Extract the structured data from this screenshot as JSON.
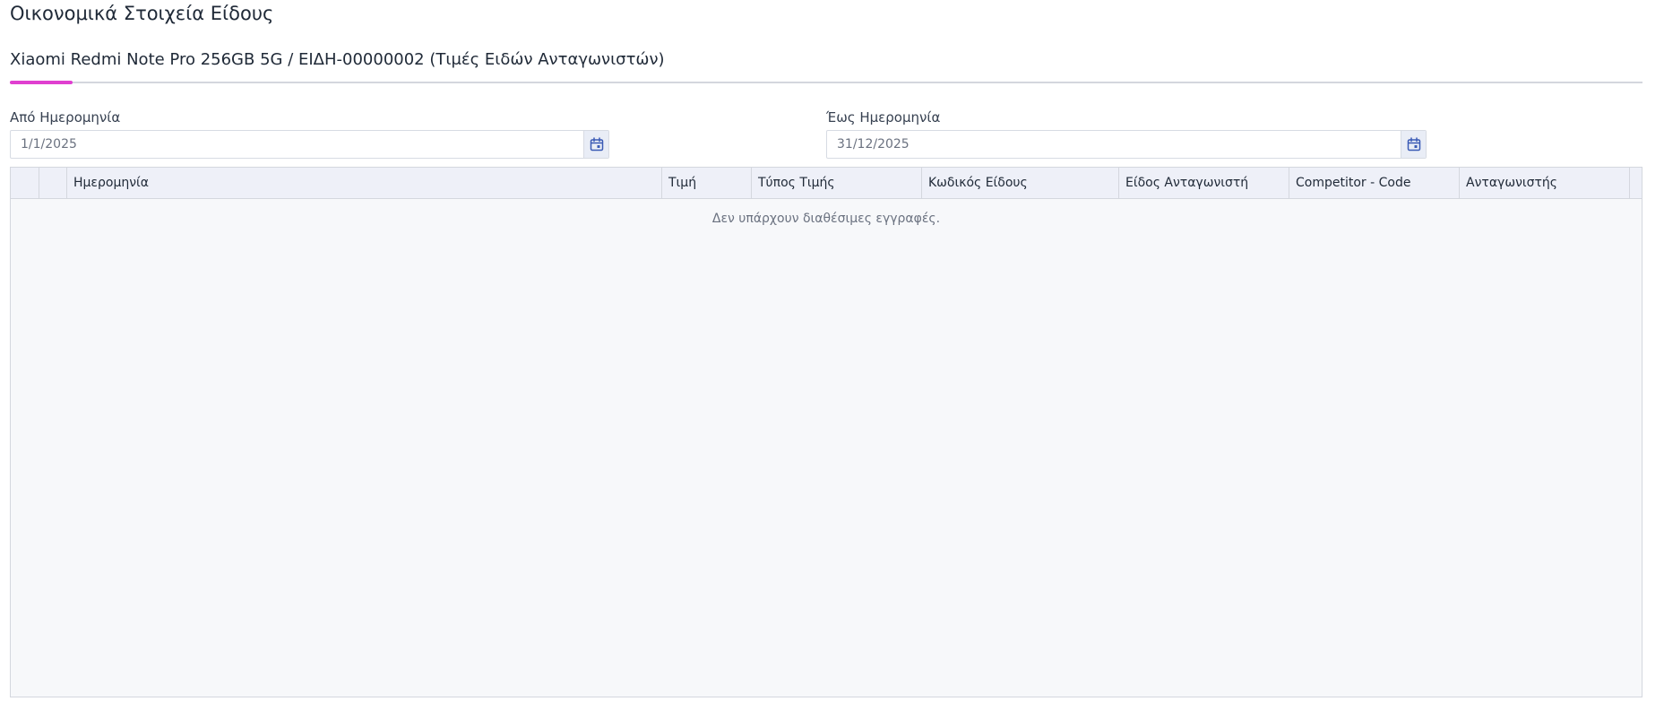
{
  "page": {
    "title": "Οικονομικά Στοιχεία Είδους"
  },
  "tab": {
    "label": "Xiaomi Redmi Note Pro 256GB 5G / ΕΙΔΗ-00000002 (Τιμές Ειδών Ανταγωνιστών)"
  },
  "filters": {
    "from": {
      "label": "Από Ημερομηνία",
      "value": "1/1/2025",
      "icon": "calendar-icon"
    },
    "to": {
      "label": "Έως Ημερομηνία",
      "value": "31/12/2025",
      "icon": "calendar-icon"
    }
  },
  "grid": {
    "columns": [
      "Ημερομηνία",
      "Τιμή",
      "Τύπος Τιμής",
      "Κωδικός Είδους",
      "Είδος Ανταγωνιστή",
      "Competitor - Code",
      "Ανταγωνιστής"
    ],
    "rows": [],
    "empty_message": "Δεν υπάρχουν διαθέσιμες εγγραφές."
  },
  "colors": {
    "accent": "#e03fd0",
    "calendar_icon": "#3b5bb5",
    "header_bg": "#eef0f8"
  }
}
